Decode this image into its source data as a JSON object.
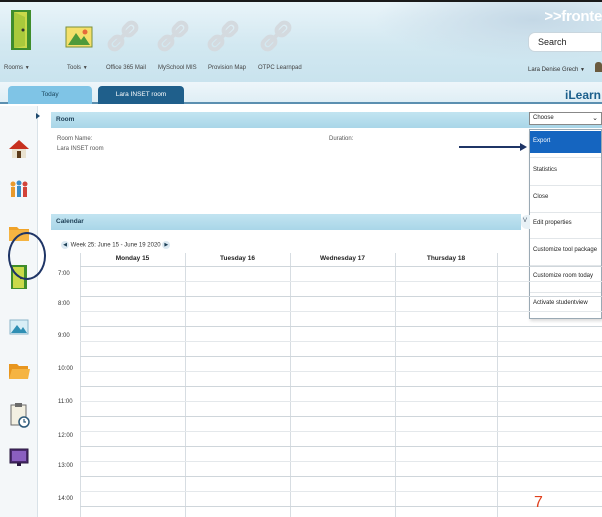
{
  "header": {
    "brand": ">>fronte",
    "search_label": "Search",
    "user_label": "Lara Denise Grech",
    "nav": [
      {
        "label": "Rooms",
        "has_caret": true
      },
      {
        "label": "Tools",
        "has_caret": true
      },
      {
        "label": "Office 365 Mail",
        "has_caret": false
      },
      {
        "label": "MySchool MIS",
        "has_caret": false
      },
      {
        "label": "Provision Map",
        "has_caret": false
      },
      {
        "label": "OTPC Learnpad",
        "has_caret": false
      }
    ]
  },
  "tabs": [
    {
      "label": "Today",
      "active": false
    },
    {
      "label": "Lara INSET room",
      "active": true
    }
  ],
  "ilearn_logo": "iLearn",
  "room": {
    "section_title": "Room",
    "room_name_label": "Room Name:",
    "room_name_value": "Lara INSET room",
    "duration_label": "Duration:"
  },
  "dropdown": {
    "selected": "Choose",
    "options": [
      {
        "label": "Export",
        "active": true
      },
      {
        "label": "Statistics",
        "active": false
      },
      {
        "label": "Close",
        "active": false
      },
      {
        "label": "Edit properties",
        "active": false
      },
      {
        "label": "Customize tool package",
        "active": false
      },
      {
        "label": "Customize room today",
        "active": false
      },
      {
        "label": "Activate studentview",
        "active": false
      }
    ]
  },
  "calendar": {
    "section_title": "Calendar",
    "view_button": "V",
    "week_label": "Week 25: June 15 - June 19 2020",
    "days": [
      "Monday 15",
      "Tuesday 16",
      "Wednesday 17",
      "Thursday 18"
    ],
    "times": [
      "7:00",
      "8:00",
      "9:00",
      "10:00",
      "11:00",
      "12:00",
      "13:00",
      "14:00"
    ]
  },
  "sidebar_icons": [
    "home-icon",
    "people-icon",
    "folder-icon",
    "door-icon",
    "photo-icon",
    "folder-open-icon",
    "clipboard-clock-icon",
    "presentation-icon"
  ],
  "slide_number": "7",
  "colors": {
    "section_bar": "#a9d6e8",
    "active_tab": "#1f5f8b",
    "menu_active": "#1565c0",
    "annotation": "#1f3566",
    "slide_number": "#e0401d"
  }
}
